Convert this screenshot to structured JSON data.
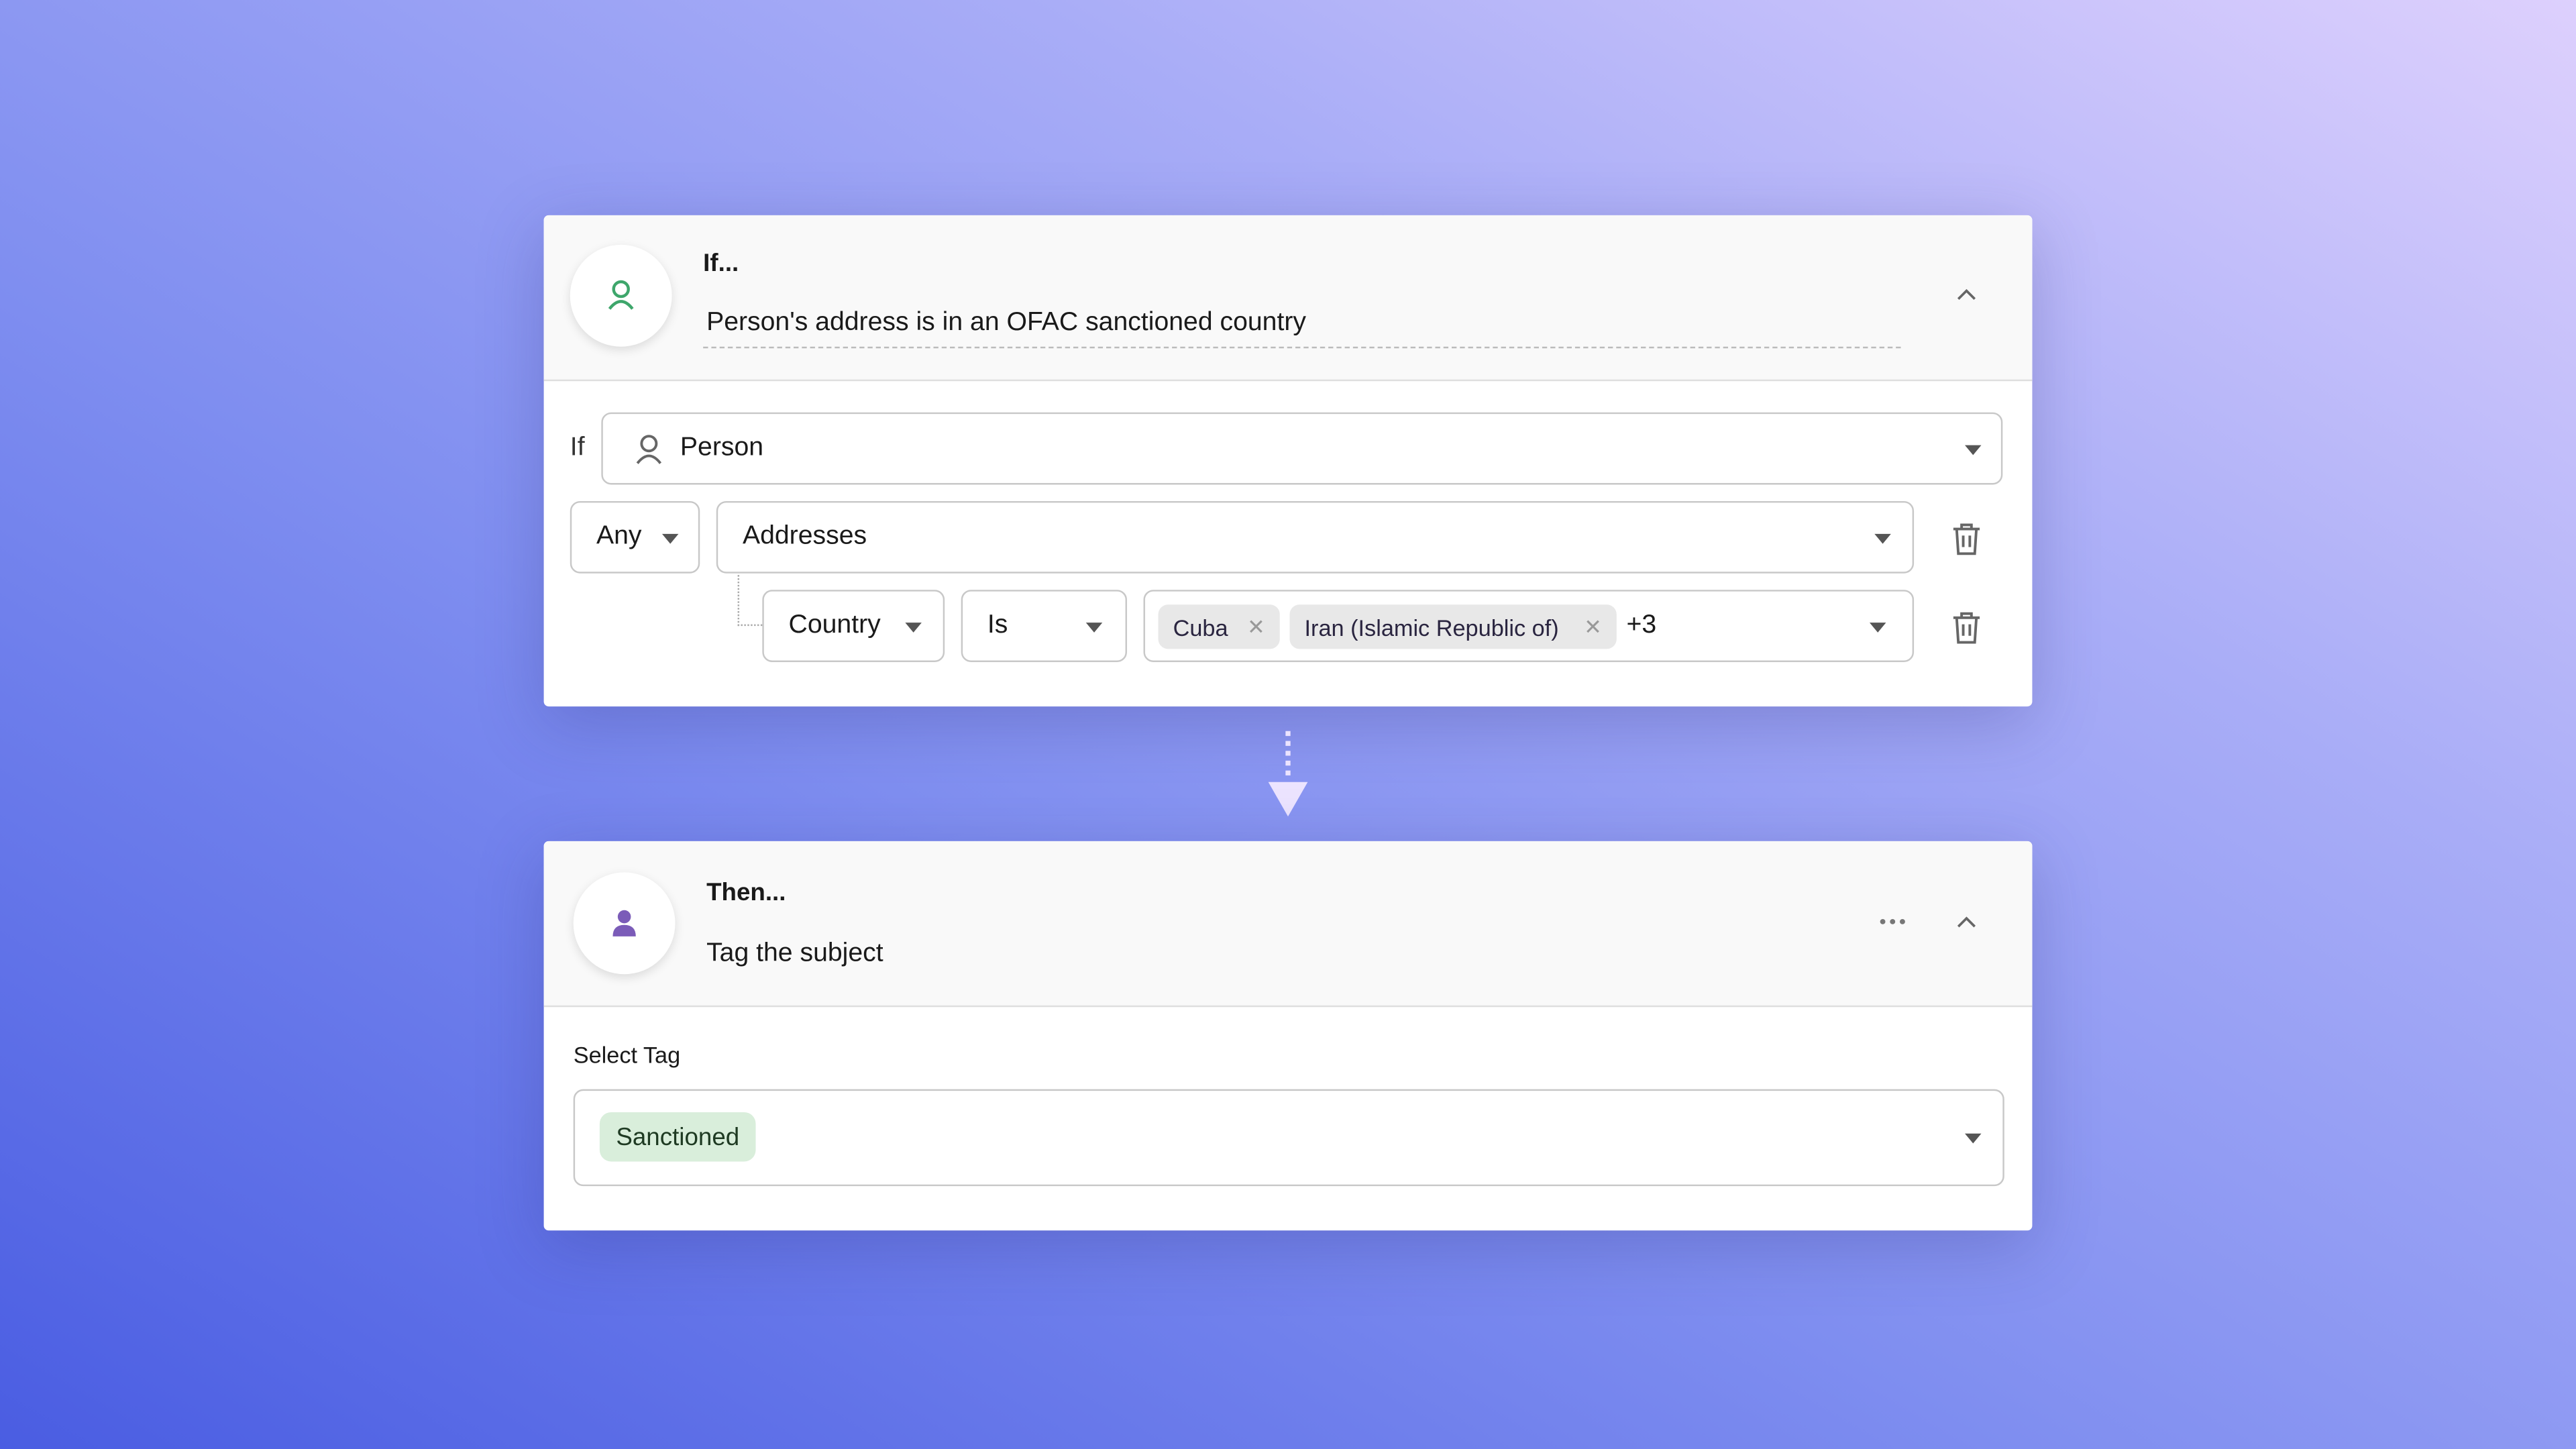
{
  "if_card": {
    "title": "If...",
    "description": "Person's address is in an OFAC sanctioned country",
    "icon": "person-outline-icon",
    "icon_color": "#3ea66b",
    "if_label": "If",
    "subject_select": "Person",
    "quantifier_select": "Any",
    "collection_select": "Addresses",
    "field_select": "Country",
    "operator_select": "Is",
    "values": [
      {
        "label": "Cuba"
      },
      {
        "label": "Iran (Islamic Republic of)"
      }
    ],
    "more_count": "+3",
    "remove_char": "✕"
  },
  "then_card": {
    "title": "Then...",
    "description": "Tag the subject",
    "icon": "person-filled-icon",
    "icon_color": "#7b5cb8",
    "select_tag_label": "Select Tag",
    "selected_tag": "Sanctioned",
    "tag_color": "#d9eedb"
  }
}
